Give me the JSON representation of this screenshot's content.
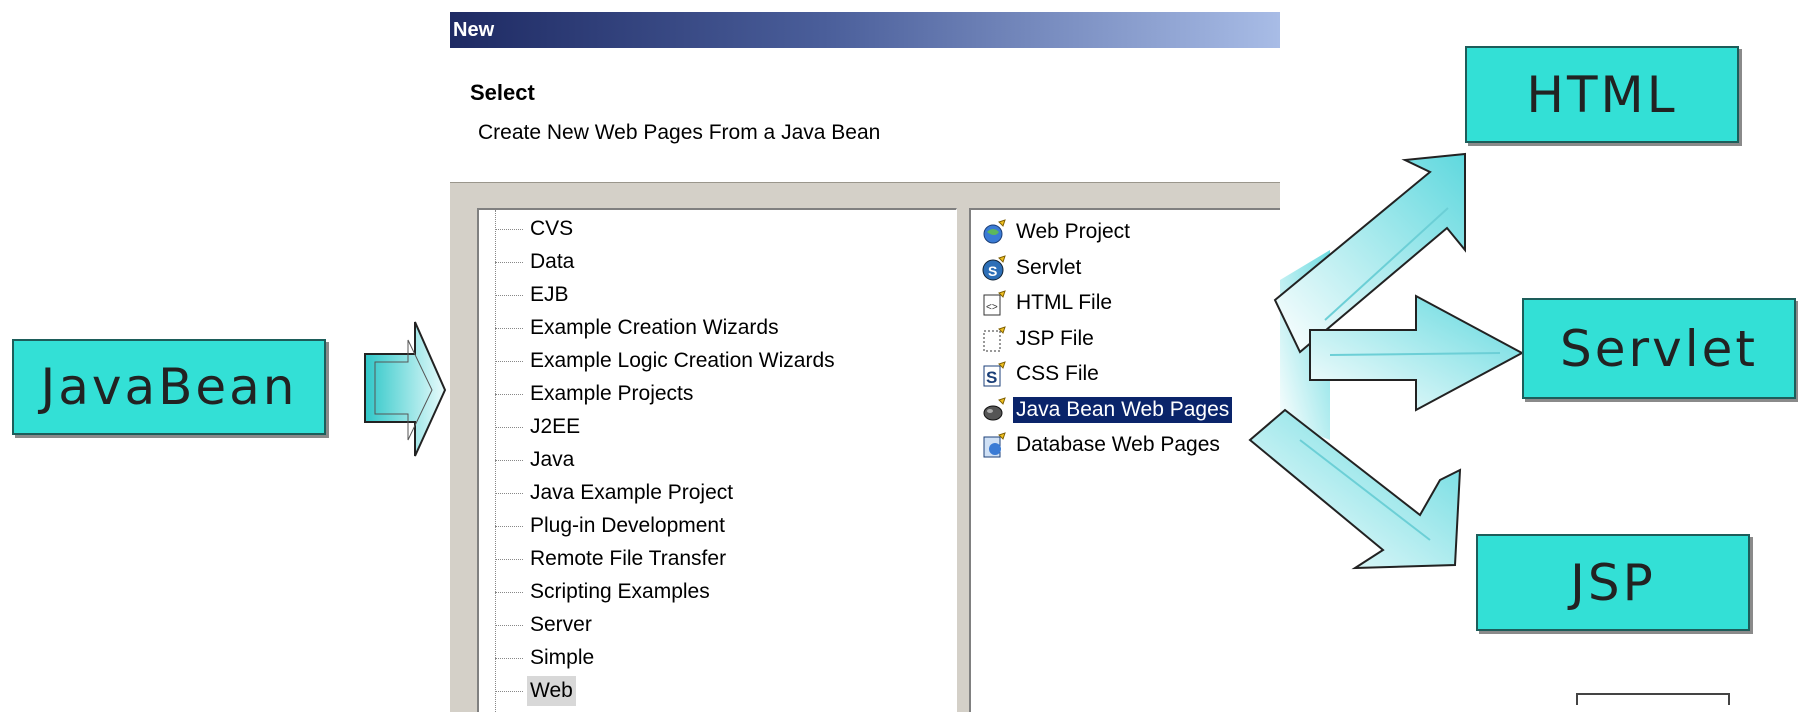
{
  "boxes": {
    "javabean": "JavaBean",
    "html": "HTML",
    "servlet": "Servlet",
    "jsp": "JSP"
  },
  "dialog": {
    "title": "New",
    "banner_title": "Select",
    "banner_description": "Create New Web Pages From a Java Bean",
    "tree_items": [
      {
        "label": "CVS"
      },
      {
        "label": "Data"
      },
      {
        "label": "EJB"
      },
      {
        "label": "Example Creation Wizards"
      },
      {
        "label": "Example Logic Creation Wizards"
      },
      {
        "label": "Example Projects"
      },
      {
        "label": "J2EE"
      },
      {
        "label": "Java"
      },
      {
        "label": "Java Example Project"
      },
      {
        "label": "Plug-in Development"
      },
      {
        "label": "Remote File Transfer"
      },
      {
        "label": "Scripting Examples"
      },
      {
        "label": "Server"
      },
      {
        "label": "Simple"
      },
      {
        "label": "Web",
        "selected": true
      }
    ],
    "wizard_items": [
      {
        "label": "Web Project",
        "icon": "web-project-icon"
      },
      {
        "label": "Servlet",
        "icon": "servlet-icon"
      },
      {
        "label": "HTML File",
        "icon": "html-file-icon"
      },
      {
        "label": "JSP File",
        "icon": "jsp-file-icon"
      },
      {
        "label": "CSS File",
        "icon": "css-file-icon"
      },
      {
        "label": "Java Bean Web Pages",
        "icon": "java-bean-web-pages-icon",
        "selected": true
      },
      {
        "label": "Database Web Pages",
        "icon": "database-web-pages-icon"
      }
    ]
  },
  "colors": {
    "box_fill": "#33e0d6",
    "arrow_fill": "#7fe3e8",
    "selection": "#0a246a",
    "titlebar_dark": "#1e2a63"
  }
}
